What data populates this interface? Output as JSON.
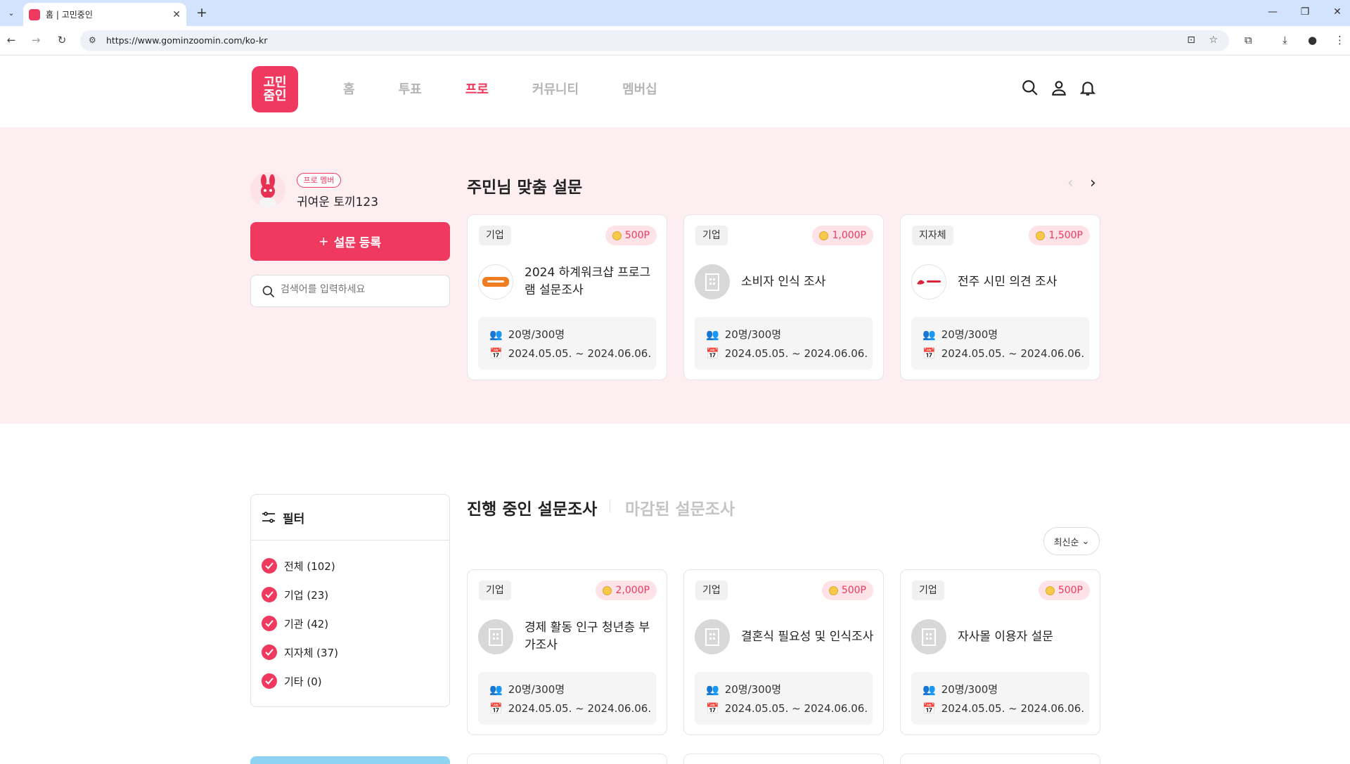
{
  "browser": {
    "tab_title": "홈 | 고민중인",
    "url": "https://www.gominzoomin.com/ko-kr"
  },
  "site": {
    "logo_lines": [
      "고민",
      "줌인"
    ],
    "nav": [
      "홈",
      "투표",
      "프로",
      "커뮤니티",
      "멤버십"
    ],
    "active_nav": "프로"
  },
  "profile": {
    "badge": "프로 멤버",
    "name": "귀여운 토끼123",
    "register_label": "설문 등록",
    "search_placeholder": "검색어를 입력하세요"
  },
  "recommended": {
    "title": "주민님 맞춤 설문",
    "cards": [
      {
        "category": "기업",
        "points": "500P",
        "logo": "telos",
        "title": "2024 하계워크샵 프로그램 설문조사",
        "participants": "20명/300명",
        "period": "2024.05.05. ~ 2024.06.06."
      },
      {
        "category": "기업",
        "points": "1,000P",
        "logo": "building",
        "title": "소비자 인식 조사",
        "participants": "20명/300명",
        "period": "2024.05.05. ~ 2024.06.06."
      },
      {
        "category": "지자체",
        "points": "1,500P",
        "logo": "jeonju",
        "title": "전주 시민 의견 조사",
        "participants": "20명/300명",
        "period": "2024.05.05. ~ 2024.06.06."
      }
    ]
  },
  "filter": {
    "title": "필터",
    "items": [
      "전체 (102)",
      "기업 (23)",
      "기관 (42)",
      "지자체 (37)",
      "기타 (0)"
    ]
  },
  "surveys": {
    "tab_active": "진행 중인 설문조사",
    "tab_inactive": "마감된 설문조사",
    "sort_label": "최신순",
    "cards": [
      {
        "category": "기업",
        "points": "2,000P",
        "logo": "building",
        "title": "경제 활동 인구 청년층 부가조사",
        "participants": "20명/300명",
        "period": "2024.05.05. ~ 2024.06.06."
      },
      {
        "category": "기업",
        "points": "500P",
        "logo": "building",
        "title": "결혼식 필요성 및 인식조사",
        "participants": "20명/300명",
        "period": "2024.05.05. ~ 2024.06.06."
      },
      {
        "category": "기업",
        "points": "500P",
        "logo": "building",
        "title": "자사몰 이용자 설문",
        "participants": "20명/300명",
        "period": "2024.05.05. ~ 2024.06.06."
      }
    ]
  },
  "colors": {
    "brand": "#f0395f",
    "hero_bg": "#fdeef1",
    "point_bg": "#fde3e8"
  }
}
